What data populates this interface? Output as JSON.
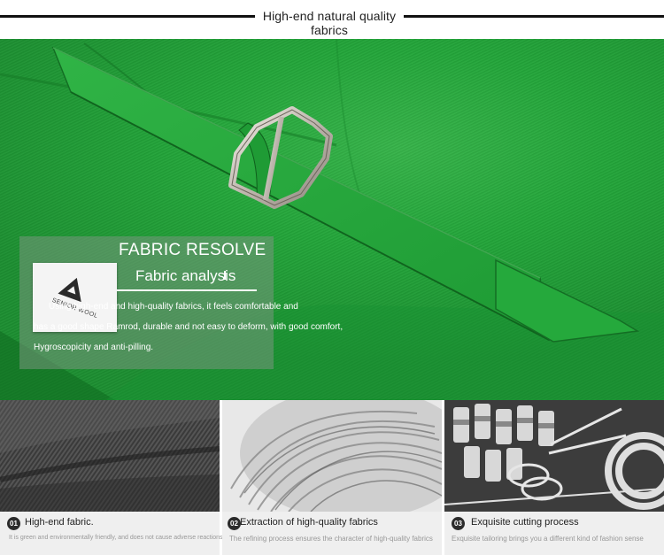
{
  "header": {
    "title": "High-end natural quality fabrics"
  },
  "hero": {
    "logo_text": "SENIOR WOOL",
    "panel_title": "FABRIC RESOLVE",
    "panel_subtitle": "Fabric analysis",
    "description_lines": [
      "Using high-end and high-quality fabrics, it feels comfortable and",
      "has a good shape Ramrod, durable and not easy to deform, with good comfort,",
      "Hygroscopicity and anti-pilling."
    ]
  },
  "features": [
    {
      "number": "01",
      "title": "High-end fabric.",
      "description": "It is green and environmentally friendly, and does not cause adverse reactions such as allergies to the human body"
    },
    {
      "number": "02",
      "title": "Extraction of high-quality fabrics",
      "description": "The refining process ensures the character of high-quality fabrics"
    },
    {
      "number": "03",
      "title": "Exquisite cutting process",
      "description": "Exquisite tailoring brings you a different kind of fashion sense"
    }
  ],
  "colors": {
    "fabric_green": "#23a63a",
    "panel_overlay": "#789682",
    "caption_bg": "#efefef"
  },
  "icons": [
    "buckle-icon",
    "senior-wool-logo-icon"
  ]
}
